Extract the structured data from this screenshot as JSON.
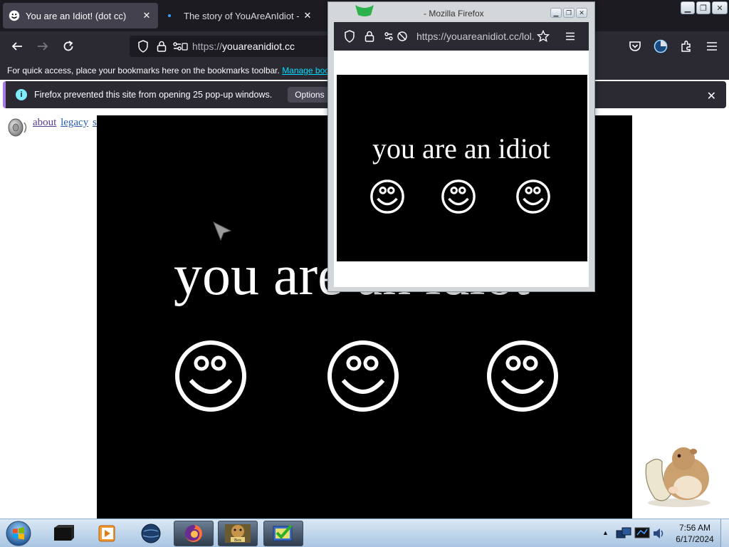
{
  "browser": {
    "tabs": [
      {
        "title": "You are an Idiot! (dot cc)",
        "active": true
      },
      {
        "title": "The story of YouAreAnIdiot - Y",
        "active": false
      }
    ],
    "url": {
      "scheme": "https://",
      "host": "youareanidiot.cc"
    },
    "bookmarks_bar": {
      "text": "For quick access, place your bookmarks here on the bookmarks toolbar.",
      "link": "Manage book"
    },
    "notification": {
      "text": "Firefox prevented this site from opening 25 pop-up windows.",
      "button": "Options"
    },
    "icons": [
      "back-icon",
      "forward-icon",
      "reload-icon",
      "shield-icon",
      "lock-icon",
      "permissions-icon",
      "pocket-icon",
      "account-icon",
      "extensions-icon",
      "menu-icon"
    ]
  },
  "page": {
    "links": [
      "about",
      "legacy",
      "safe"
    ],
    "headline": "you are an idiot",
    "smiley_count": 3
  },
  "popup": {
    "window_title": "- Mozilla Firefox",
    "url": "https://youareanidiot.cc/lol.",
    "headline": "you are an idiot"
  },
  "taskbar": {
    "time": "7:56 AM",
    "date": "6/17/2024",
    "box_label": "Box"
  },
  "colors": {
    "tab_strip": "#1c1b22",
    "toolbar": "#2b2a33",
    "accent_link": "#00ddff",
    "notification_bar": "#a57ae8",
    "stage": "#000000"
  }
}
